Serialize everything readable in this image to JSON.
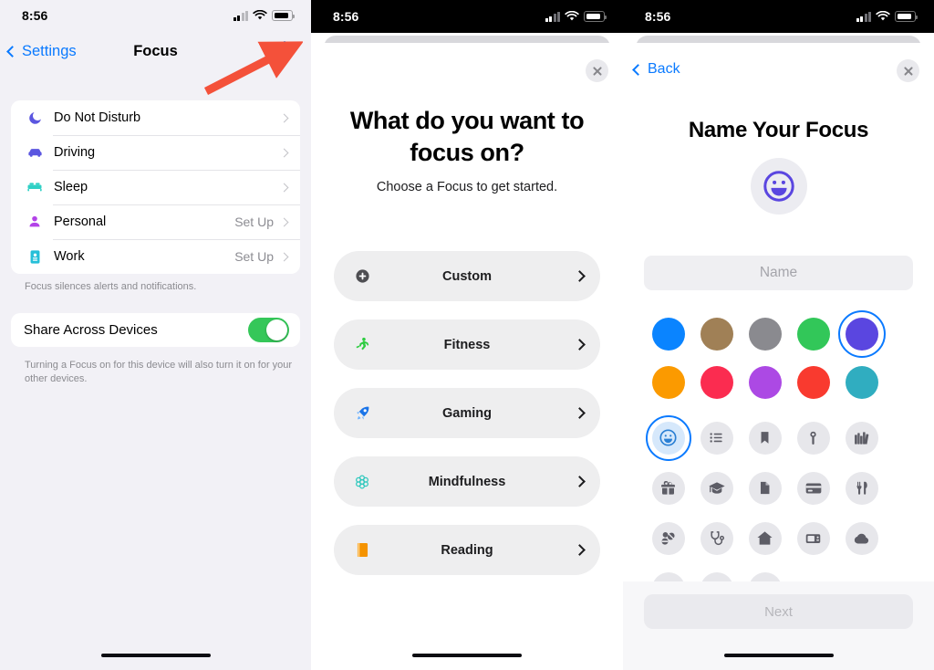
{
  "status_bar": {
    "time": "8:56"
  },
  "panel1": {
    "nav": {
      "back_label": "Settings",
      "title": "Focus",
      "add_icon": "plus-icon"
    },
    "focus_items": [
      {
        "label": "Do Not Disturb",
        "value": "",
        "icon": "moon-icon",
        "color": "#5b56e0"
      },
      {
        "label": "Driving",
        "value": "",
        "icon": "car-icon",
        "color": "#5b56e0"
      },
      {
        "label": "Sleep",
        "value": "",
        "icon": "bed-icon",
        "color": "#2fd0c5"
      },
      {
        "label": "Personal",
        "value": "Set Up",
        "icon": "person-icon",
        "color": "#b343e8"
      },
      {
        "label": "Work",
        "value": "Set Up",
        "icon": "id-badge-icon",
        "color": "#25bfd8"
      }
    ],
    "footer_note": "Focus silences alerts and notifications.",
    "share": {
      "label": "Share Across Devices",
      "toggle_state": "on",
      "toggle_color": "#35c759",
      "note": "Turning a Focus on for this device will also turn it on for your other devices."
    }
  },
  "panel2": {
    "close_icon": "close-icon",
    "title": "What do you want to focus on?",
    "subtitle": "Choose a Focus to get started.",
    "options": [
      {
        "label": "Custom",
        "icon": "plus-circle-icon"
      },
      {
        "label": "Fitness",
        "icon": "running-person-icon"
      },
      {
        "label": "Gaming",
        "icon": "rocket-icon"
      },
      {
        "label": "Mindfulness",
        "icon": "flower-icon"
      },
      {
        "label": "Reading",
        "icon": "book-icon"
      }
    ]
  },
  "panel3": {
    "back_label": "Back",
    "close_icon": "close-icon",
    "title": "Name Your Focus",
    "avatar_icon": "smiley-face-icon",
    "name_field": {
      "value": "",
      "placeholder": "Name"
    },
    "colors": [
      {
        "name": "blue",
        "hex": "#0a84ff",
        "selected": false
      },
      {
        "name": "brown",
        "hex": "#a08056",
        "selected": false
      },
      {
        "name": "gray",
        "hex": "#8a8a8f",
        "selected": false
      },
      {
        "name": "green",
        "hex": "#32c759",
        "selected": false
      },
      {
        "name": "indigo",
        "hex": "#5a46e0",
        "selected": true
      },
      {
        "name": "orange",
        "hex": "#fb9a00",
        "selected": false
      },
      {
        "name": "pink",
        "hex": "#fb2c50",
        "selected": false
      },
      {
        "name": "purple",
        "hex": "#ac49e4",
        "selected": false
      },
      {
        "name": "red",
        "hex": "#f93a2f",
        "selected": false
      },
      {
        "name": "teal",
        "hex": "#30adc0",
        "selected": false
      }
    ],
    "icons": [
      {
        "name": "smiley-face-icon",
        "selected": true
      },
      {
        "name": "list-icon",
        "selected": false
      },
      {
        "name": "bookmark-icon",
        "selected": false
      },
      {
        "name": "pin-icon",
        "selected": false
      },
      {
        "name": "books-icon",
        "selected": false
      },
      {
        "name": "gift-icon",
        "selected": false
      },
      {
        "name": "graduation-cap-icon",
        "selected": false
      },
      {
        "name": "document-icon",
        "selected": false
      },
      {
        "name": "credit-card-icon",
        "selected": false
      },
      {
        "name": "fork-knife-icon",
        "selected": false
      },
      {
        "name": "pills-icon",
        "selected": false
      },
      {
        "name": "stethoscope-icon",
        "selected": false
      },
      {
        "name": "house-icon",
        "selected": false
      },
      {
        "name": "tv-icon",
        "selected": false
      },
      {
        "name": "cloud-icon",
        "selected": false
      },
      {
        "name": "monitor-icon",
        "selected": false
      },
      {
        "name": "circle-icon",
        "selected": false
      },
      {
        "name": "flag-icon",
        "selected": false
      }
    ],
    "next_button": {
      "label": "Next",
      "state": "disabled"
    }
  },
  "annotation": {
    "arrow_color": "#f4513a",
    "points_to": "plus-icon"
  }
}
